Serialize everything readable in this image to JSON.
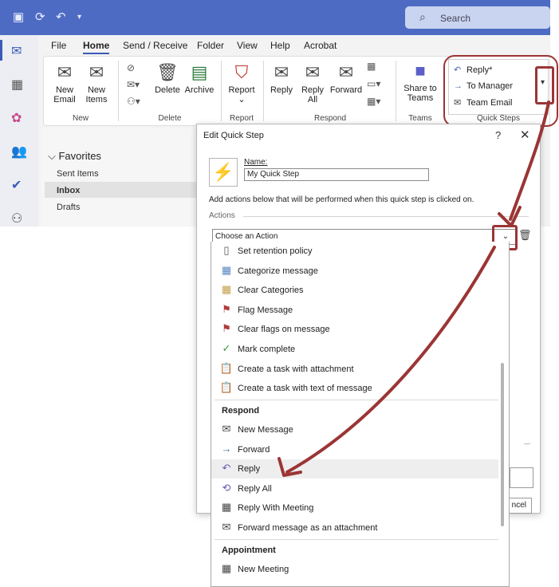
{
  "titlebar": {
    "search_placeholder": "Search",
    "color": "#4e6bc4"
  },
  "menu": [
    "File",
    "Home",
    "Send / Receive",
    "Folder",
    "View",
    "Help",
    "Acrobat"
  ],
  "ribbon": {
    "new_email": "New Email",
    "new_items": "New Items",
    "delete": "Delete",
    "archive": "Archive",
    "report_btn": "Report",
    "reply": "Reply",
    "reply_all": "Reply All",
    "forward": "Forward",
    "share_to_teams": "Share to Teams",
    "groups": {
      "new": "New",
      "delete": "Delete",
      "report": "Report",
      "respond": "Respond",
      "teams": "Teams",
      "quick_steps": "Quick Steps"
    }
  },
  "quick_steps": [
    "Reply*",
    "To Manager",
    "Team Email"
  ],
  "favorites": {
    "title": "Favorites",
    "items": [
      "Sent Items",
      "Inbox",
      "Drafts"
    ]
  },
  "dialog": {
    "title": "Edit Quick Step",
    "help": "?",
    "close": "✕",
    "name_label": "Name:",
    "name_value": "My Quick Step",
    "description": "Add actions below that will be performed when this quick step is clicked on.",
    "actions_label": "Actions",
    "combo_value": "Choose an Action",
    "cancel_label": "ncel"
  },
  "dropdown": {
    "items_top": [
      {
        "label": "Set retention policy",
        "icon": "document-icon"
      },
      {
        "label": "Categorize message",
        "icon": "categorize-icon"
      },
      {
        "label": "Clear Categories",
        "icon": "categorize-icon"
      },
      {
        "label": "Flag Message",
        "icon": "flag-icon"
      },
      {
        "label": "Clear flags on message",
        "icon": "flag-icon"
      },
      {
        "label": "Mark complete",
        "icon": "checkmark-icon"
      },
      {
        "label": "Create a task with attachment",
        "icon": "clipboard-icon"
      },
      {
        "label": "Create a task with text of message",
        "icon": "clipboard-icon"
      }
    ],
    "respond_header": "Respond",
    "respond_items": [
      {
        "label": "New Message",
        "icon": "envelope-icon"
      },
      {
        "label": "Forward",
        "icon": "forward-arrow-icon"
      },
      {
        "label": "Reply",
        "icon": "reply-arrow-icon"
      },
      {
        "label": "Reply All",
        "icon": "reply-all-icon"
      },
      {
        "label": "Reply With Meeting",
        "icon": "calendar-icon"
      },
      {
        "label": "Forward message as an attachment",
        "icon": "envelope-icon"
      }
    ],
    "appointment_header": "Appointment",
    "appointment_items": [
      {
        "label": "New Meeting",
        "icon": "calendar-icon"
      }
    ]
  },
  "annotation_color": "#9b3535"
}
